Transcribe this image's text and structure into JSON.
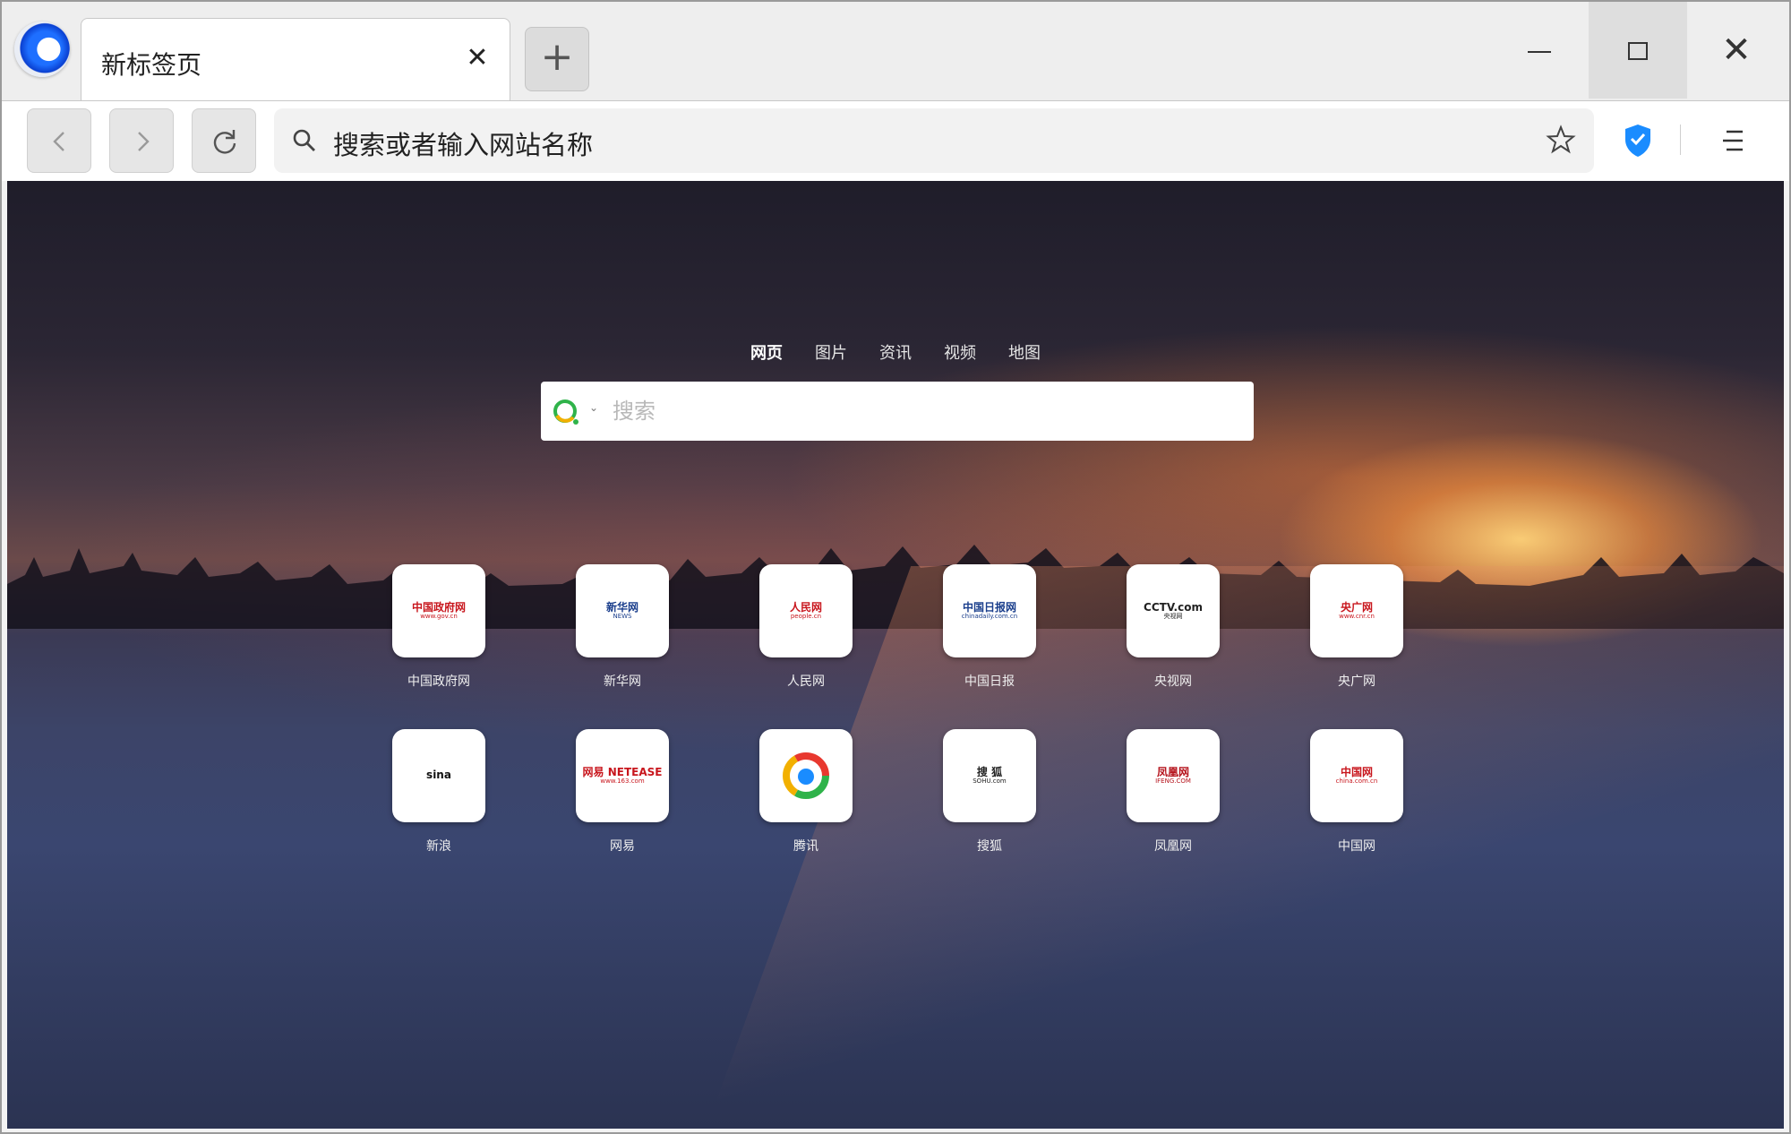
{
  "browser": {
    "tab": {
      "title": "新标签页",
      "close_glyph": "✕"
    },
    "new_tab_glyph": "+",
    "window_controls": {
      "close_glyph": "✕"
    },
    "address_bar": {
      "placeholder": "搜索或者输入网站名称"
    }
  },
  "newtab": {
    "search_tabs": [
      "网页",
      "图片",
      "资讯",
      "视频",
      "地图"
    ],
    "active_search_tab": "网页",
    "search_placeholder": "搜索",
    "engine_caret": "⌄",
    "tiles": [
      {
        "label": "中国政府网",
        "logo_text": "中国政府网",
        "logo_sub": "www.gov.cn",
        "color": "#c8161d"
      },
      {
        "label": "新华网",
        "logo_text": "新华网",
        "logo_sub": "NEWS",
        "color": "#1a3e8c"
      },
      {
        "label": "人民网",
        "logo_text": "人民网",
        "logo_sub": "people.cn",
        "color": "#c8161d"
      },
      {
        "label": "中国日报",
        "logo_text": "中国日报网",
        "logo_sub": "chinadaily.com.cn",
        "color": "#1a3e8c"
      },
      {
        "label": "央视网",
        "logo_text": "CCTV.com",
        "logo_sub": "央视网",
        "color": "#222222"
      },
      {
        "label": "央广网",
        "logo_text": "央广网",
        "logo_sub": "www.cnr.cn",
        "color": "#c8161d"
      },
      {
        "label": "新浪",
        "logo_text": "sina",
        "logo_sub": "",
        "color": "#111111"
      },
      {
        "label": "网易",
        "logo_text": "网易 NETEASE",
        "logo_sub": "www.163.com",
        "color": "#c8161d"
      },
      {
        "label": "腾讯",
        "logo_text": "",
        "logo_sub": "",
        "color": "#1a8cff"
      },
      {
        "label": "搜狐",
        "logo_text": "搜 狐",
        "logo_sub": "SOHU.com",
        "color": "#222222"
      },
      {
        "label": "凤凰网",
        "logo_text": "凤凰网",
        "logo_sub": "IFENG.COM",
        "color": "#b5121b"
      },
      {
        "label": "中国网",
        "logo_text": "中国网",
        "logo_sub": "china.com.cn",
        "color": "#c8161d"
      }
    ]
  },
  "colors": {
    "accent_shield": "#1a8cff",
    "tile_bg": "#ffffff"
  }
}
